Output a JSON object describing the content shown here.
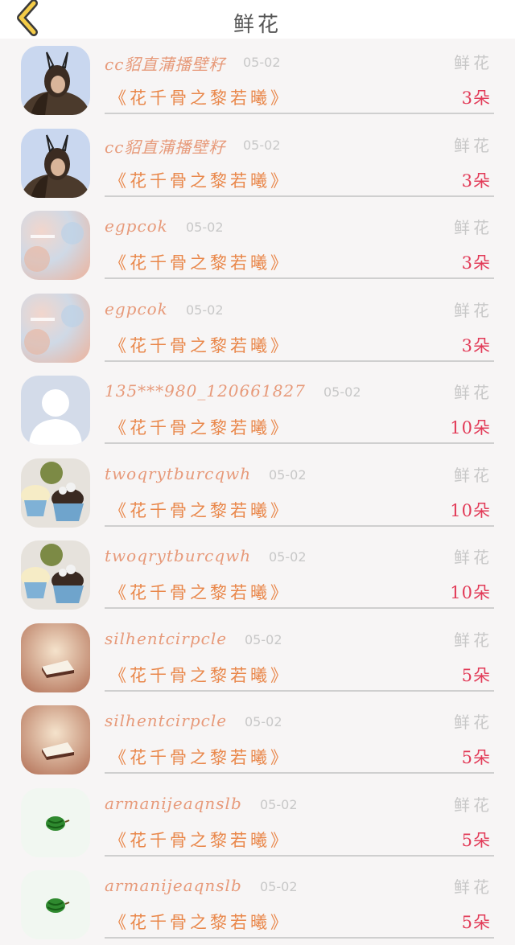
{
  "header": {
    "title": "鲜花"
  },
  "records": [
    {
      "user": "cc貂直蒲播壁籽",
      "date": "05-02",
      "tag": "鲜花",
      "book": "《花千骨之黎若曦》",
      "count": "3朵",
      "avatar": "girl-bunny-ears-avatar"
    },
    {
      "user": "cc貂直蒲播壁籽",
      "date": "05-02",
      "tag": "鲜花",
      "book": "《花千骨之黎若曦》",
      "count": "3朵",
      "avatar": "girl-bunny-ears-avatar"
    },
    {
      "user": "egpcok",
      "date": "05-02",
      "tag": "鲜花",
      "book": "《花千骨之黎若曦》",
      "count": "3朵",
      "avatar": "blurry-pastel-avatar"
    },
    {
      "user": "egpcok",
      "date": "05-02",
      "tag": "鲜花",
      "book": "《花千骨之黎若曦》",
      "count": "3朵",
      "avatar": "blurry-pastel-avatar"
    },
    {
      "user": "135***980_120661827",
      "date": "05-02",
      "tag": "鲜花",
      "book": "《花千骨之黎若曦》",
      "count": "10朵",
      "avatar": "default-person-avatar"
    },
    {
      "user": "twoqrytburcqwh",
      "date": "05-02",
      "tag": "鲜花",
      "book": "《花千骨之黎若曦》",
      "count": "10朵",
      "avatar": "cupcakes-avatar"
    },
    {
      "user": "twoqrytburcqwh",
      "date": "05-02",
      "tag": "鲜花",
      "book": "《花千骨之黎若曦》",
      "count": "10朵",
      "avatar": "cupcakes-avatar"
    },
    {
      "user": "silhentcirpcle",
      "date": "05-02",
      "tag": "鲜花",
      "book": "《花千骨之黎若曦》",
      "count": "5朵",
      "avatar": "cake-slice-avatar"
    },
    {
      "user": "silhentcirpcle",
      "date": "05-02",
      "tag": "鲜花",
      "book": "《花千骨之黎若曦》",
      "count": "5朵",
      "avatar": "cake-slice-avatar"
    },
    {
      "user": "armanijeaqnslb",
      "date": "05-02",
      "tag": "鲜花",
      "book": "《花千骨之黎若曦》",
      "count": "5朵",
      "avatar": "watermelon-avatar"
    },
    {
      "user": "armanijeaqnslb",
      "date": "05-02",
      "tag": "鲜花",
      "book": "《花千骨之黎若曦》",
      "count": "5朵",
      "avatar": "watermelon-avatar"
    }
  ]
}
